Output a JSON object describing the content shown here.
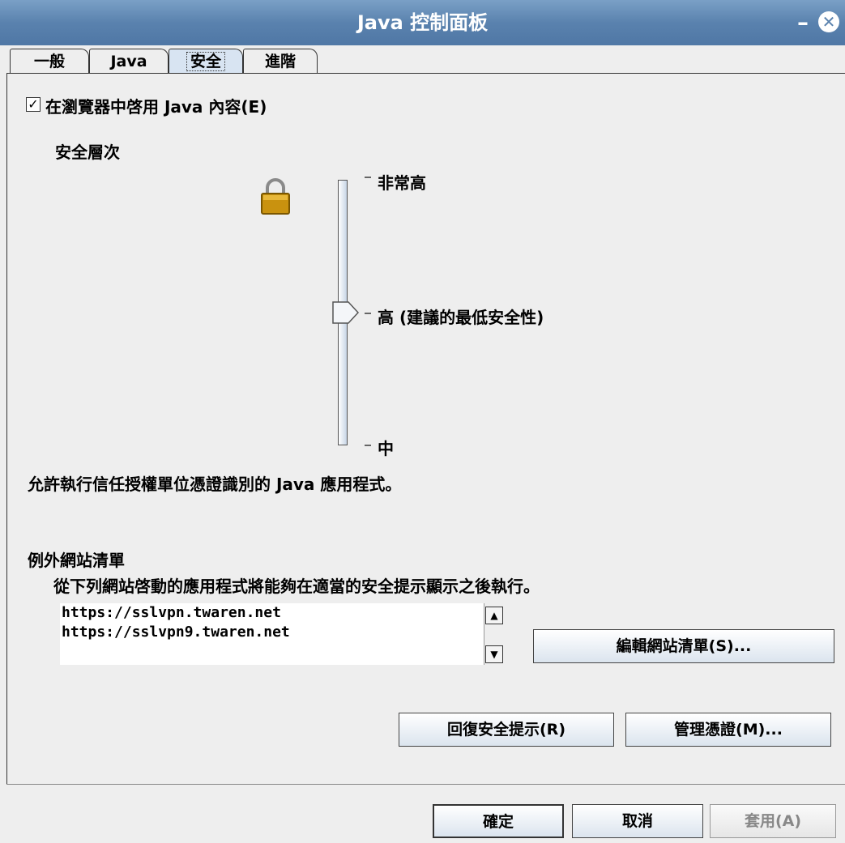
{
  "window": {
    "title": "Java 控制面板",
    "minimize": "–",
    "close": "✕"
  },
  "tabs": [
    "一般",
    "Java",
    "安全",
    "進階"
  ],
  "security": {
    "enable_checkbox_label": "在瀏覽器中啓用 Java 內容(E)",
    "enable_checked": true,
    "level_heading": "安全層次",
    "levels": [
      "非常高",
      "高 (建議的最低安全性)",
      "中"
    ],
    "selected_level": "高 (建議的最低安全性)",
    "description": "允許執行信任授權單位憑證識別的 Java 應用程式。"
  },
  "exception_list": {
    "heading": "例外網站清單",
    "subtitle": "從下列網站啓動的應用程式將能夠在適當的安全提示顯示之後執行。",
    "sites": [
      "https://sslvpn.twaren.net",
      "https://sslvpn9.twaren.net"
    ],
    "edit_button": "編輯網站清單(S)..."
  },
  "buttons": {
    "restore_prompts": "回復安全提示(R)",
    "manage_certs": "管理憑證(M)...",
    "ok": "確定",
    "cancel": "取消",
    "apply": "套用(A)"
  },
  "icons": {
    "lock": "lock-icon",
    "scroll_up": "arrow-up-icon",
    "scroll_down": "arrow-down-icon"
  }
}
